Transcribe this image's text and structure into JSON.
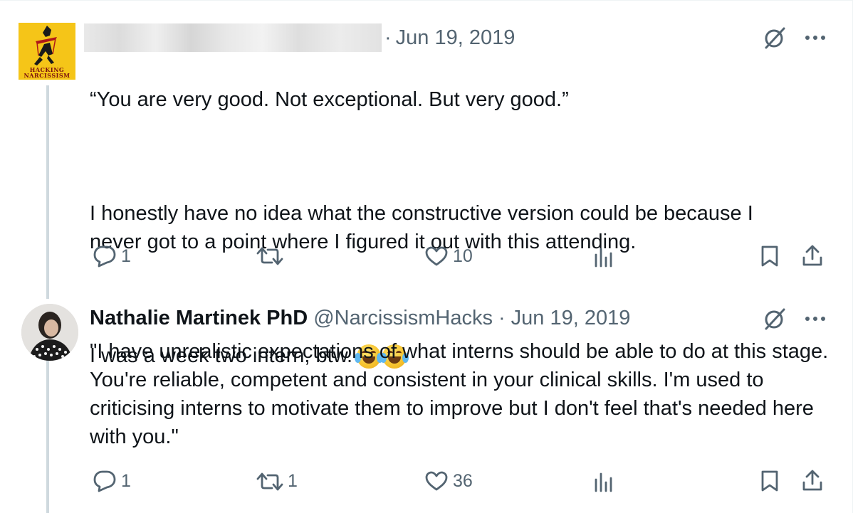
{
  "tweet1": {
    "author_name_redacted": true,
    "avatar": {
      "icon": "hacking-narcissism-logo",
      "label": "HACKING NARCISSISM"
    },
    "separator": "·",
    "date": "Jun 19, 2019",
    "paragraphs": [
      "“You are very good. Not exceptional. But very good.”",
      "I honestly have no idea what the constructive version could be because I never got to a point where I figured it out with this attending.",
      "I was a week two intern, btw."
    ],
    "emoji": "😂😂",
    "actions": {
      "replies": "1",
      "retweets": "",
      "likes": "10"
    }
  },
  "tweet2": {
    "avatar": {
      "icon": "profile-photo"
    },
    "display_name": "Nathalie Martinek PhD",
    "handle": "@NarcissismHacks",
    "separator": "·",
    "date": "Jun 19, 2019",
    "text": "\"I have unrealistic expectations of what interns should be able to do at this stage. You're reliable, competent and consistent in your clinical skills. I'm used to criticising interns to motivate them to improve but I don't feel that's needed here with you.\"",
    "actions": {
      "replies": "1",
      "retweets": "1",
      "likes": "36"
    }
  },
  "icons": {
    "grok": "grok-icon",
    "more": "more-icon",
    "reply": "reply-icon",
    "retweet": "retweet-icon",
    "like": "like-icon",
    "views": "views-icon",
    "bookmark": "bookmark-icon",
    "share": "share-icon"
  },
  "colors": {
    "text": "#0f1419",
    "secondary": "#536471",
    "thread_line": "#cfd9de",
    "avatar_bg": "#f5c518"
  }
}
